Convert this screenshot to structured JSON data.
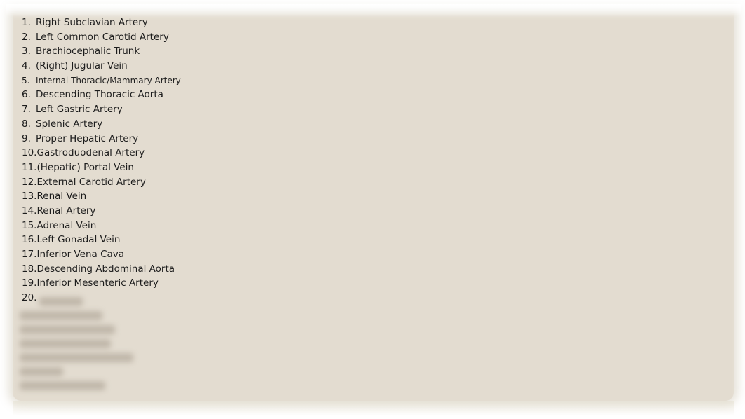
{
  "slide": {
    "items": [
      {
        "number": "1.",
        "label": "Right Subclavian Artery"
      },
      {
        "number": "2.",
        "label": "Left Common Carotid Artery"
      },
      {
        "number": "3.",
        "label": "Brachiocephalic Trunk"
      },
      {
        "number": "4.",
        "label": "(Right) Jugular Vein"
      },
      {
        "number": "5.",
        "label": "Internal Thoracic/Mammary Artery"
      },
      {
        "number": "6.",
        "label": "Descending Thoracic Aorta"
      },
      {
        "number": "7.",
        "label": "Left Gastric Artery"
      },
      {
        "number": "8.",
        "label": "Splenic Artery"
      },
      {
        "number": "9.",
        "label": "Proper Hepatic Artery"
      },
      {
        "number": "10.",
        "label": "Gastroduodenal Artery"
      },
      {
        "number": "11.",
        "label": "(Hepatic) Portal Vein"
      },
      {
        "number": "12.",
        "label": "External Carotid Artery"
      },
      {
        "number": "13.",
        "label": "Renal Vein"
      },
      {
        "number": "14.",
        "label": "Renal Artery"
      },
      {
        "number": "15.",
        "label": "Adrenal Vein"
      },
      {
        "number": "16.",
        "label": "Left Gonadal Vein"
      },
      {
        "number": "17.",
        "label": "Inferior Vena Cava"
      },
      {
        "number": "18.",
        "label": "Descending Abdominal Aorta"
      },
      {
        "number": "19.",
        "label": "Inferior Mesenteric Artery"
      },
      {
        "number": "20.",
        "label": ""
      }
    ],
    "blurred_items_count": 7
  },
  "colors": {
    "card_background": "#e3dcd0",
    "text": "#1c1c1c",
    "page_background": "#ffffff"
  }
}
